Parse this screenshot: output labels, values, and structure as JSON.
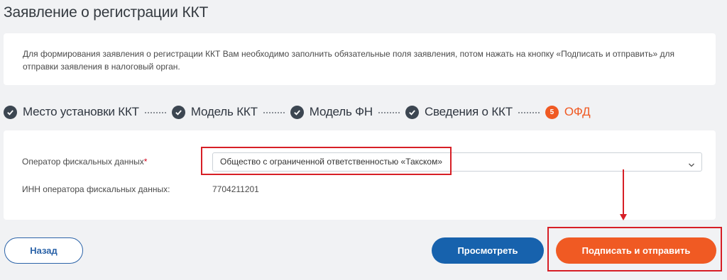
{
  "page": {
    "title": "Заявление о регистрации ККТ"
  },
  "info": {
    "text": "Для формирования заявления о регистрации ККТ Вам необходимо заполнить обязательные поля заявления, потом нажать на кнопку «Подписать и отправить» для отправки заявления в налоговый орган."
  },
  "stepper": {
    "steps": [
      {
        "label": "Место установки ККТ",
        "state": "done"
      },
      {
        "label": "Модель ККТ",
        "state": "done"
      },
      {
        "label": "Модель ФН",
        "state": "done"
      },
      {
        "label": "Сведения о ККТ",
        "state": "done"
      },
      {
        "label": "ОФД",
        "state": "active",
        "number": "5"
      }
    ]
  },
  "form": {
    "ofd_label": "Оператор фискальных данных",
    "required_mark": "*",
    "ofd_value": "Общество с ограниченной ответственностью «Такском»",
    "inn_label": "ИНН оператора фискальных данных:",
    "inn_value": "7704211201"
  },
  "buttons": {
    "back": "Назад",
    "view": "Просмотреть",
    "submit": "Подписать и отправить"
  },
  "colors": {
    "accent_orange": "#f05a23",
    "primary_blue": "#1762ad",
    "annotation_red": "#d71f26"
  }
}
